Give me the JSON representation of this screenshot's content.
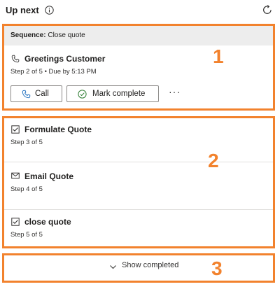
{
  "header": {
    "title": "Up next"
  },
  "active": {
    "sequence_label": "Sequence:",
    "sequence_name": "Close quote",
    "title": "Greetings Customer",
    "subtitle": "Step 2 of 5 • Due by 5:13 PM",
    "call_label": "Call",
    "complete_label": "Mark complete",
    "more_label": "···"
  },
  "upcoming": [
    {
      "title": "Formulate Quote",
      "subtitle": "Step 3 of 5",
      "icon": "checkbox-icon"
    },
    {
      "title": "Email Quote",
      "subtitle": "Step 4 of 5",
      "icon": "mail-icon"
    },
    {
      "title": "close quote",
      "subtitle": "Step 5 of 5",
      "icon": "checkbox-icon"
    }
  ],
  "footer": {
    "show_completed_label": "Show completed"
  },
  "callouts": [
    "1",
    "2",
    "3"
  ],
  "colors": {
    "callout": "#f2822d",
    "band": "#ededed",
    "border": "#8a8886"
  }
}
